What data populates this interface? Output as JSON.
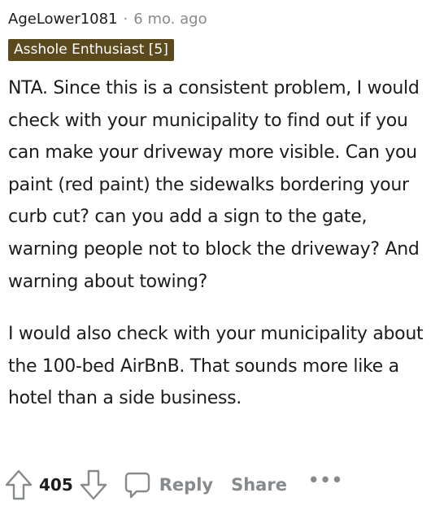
{
  "comment": {
    "author": "AgeLower1081",
    "separator": "·",
    "time": "6 mo. ago",
    "flair": "Asshole Enthusiast [5]",
    "paragraphs": [
      "NTA. Since this is a consistent problem, I would check with your municipality to find out if you can make your driveway more visible. Can you paint (red paint) the sidewalks bordering your curb cut? can you add a sign to the gate, warning people not to block the driveway? And warning about towing?",
      "I would also check with your municipality about the 100-bed AirBnB. That sounds more like a hotel than a side business."
    ]
  },
  "actions": {
    "upvote_icon": "arrow-up-icon",
    "score": "405",
    "downvote_icon": "arrow-down-icon",
    "reply_icon": "speech-bubble-icon",
    "reply_label": "Reply",
    "share_label": "Share",
    "more_label": "•••"
  },
  "colors": {
    "text": "#1c1c1c",
    "muted": "#878a8c",
    "flair_bg": "#5c4a1f",
    "flair_text": "#ffffff"
  }
}
